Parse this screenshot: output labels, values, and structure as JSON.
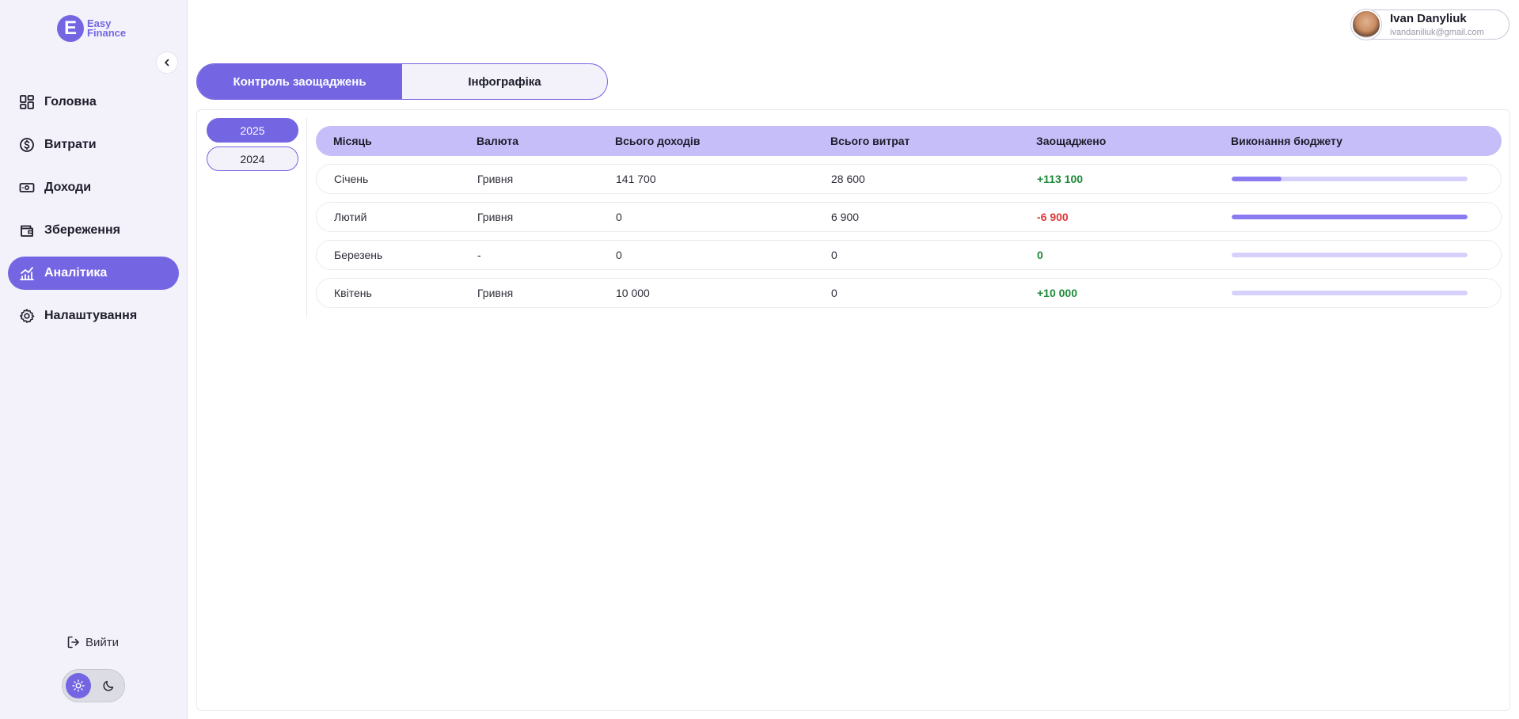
{
  "brand": {
    "line1": "Easy",
    "line2": "Finance",
    "mark": "E",
    "accent": "#7465e3"
  },
  "sidebar": {
    "items": [
      {
        "label": "Головна",
        "icon": "dashboard-icon"
      },
      {
        "label": "Витрати",
        "icon": "dollar-circle-icon"
      },
      {
        "label": "Доходи",
        "icon": "cash-icon"
      },
      {
        "label": "Збереження",
        "icon": "wallet-icon"
      },
      {
        "label": "Аналітика",
        "icon": "analytics-icon",
        "active": true
      },
      {
        "label": "Налаштування",
        "icon": "gear-icon"
      }
    ],
    "logout_label": "Вийти"
  },
  "user": {
    "name": "Ivan Danyliuk",
    "email": "ivandaniliuk@gmail.com"
  },
  "tabs": [
    {
      "label": "Контроль заощаджень",
      "active": true
    },
    {
      "label": "Інфографіка",
      "active": false
    }
  ],
  "years": [
    {
      "label": "2025",
      "active": true
    },
    {
      "label": "2024",
      "active": false
    }
  ],
  "table": {
    "headers": [
      "Місяць",
      "Валюта",
      "Всього доходів",
      "Всього витрат",
      "Заощаджено",
      "Виконання бюджету"
    ],
    "rows": [
      {
        "month": "Січень",
        "currency": "Гривня",
        "income": "141 700",
        "expenses": "28 600",
        "saved": "+113 100",
        "saved_status": "pos",
        "budget_progress": 0.21
      },
      {
        "month": "Лютий",
        "currency": "Гривня",
        "income": "0",
        "expenses": "6 900",
        "saved": "-6 900",
        "saved_status": "neg",
        "budget_progress": 1.0
      },
      {
        "month": "Березень",
        "currency": "-",
        "income": "0",
        "expenses": "0",
        "saved": "0",
        "saved_status": "zero",
        "budget_progress": 0.0
      },
      {
        "month": "Квітень",
        "currency": "Гривня",
        "income": "10 000",
        "expenses": "0",
        "saved": "+10 000",
        "saved_status": "pos",
        "budget_progress": 0.0
      }
    ]
  },
  "colors": {
    "positive": "#1e8a3a",
    "negative": "#e03636",
    "header_bg": "#c5bef8",
    "progress_fill": "#8a7cf0",
    "progress_track": "#d6d1fb"
  }
}
